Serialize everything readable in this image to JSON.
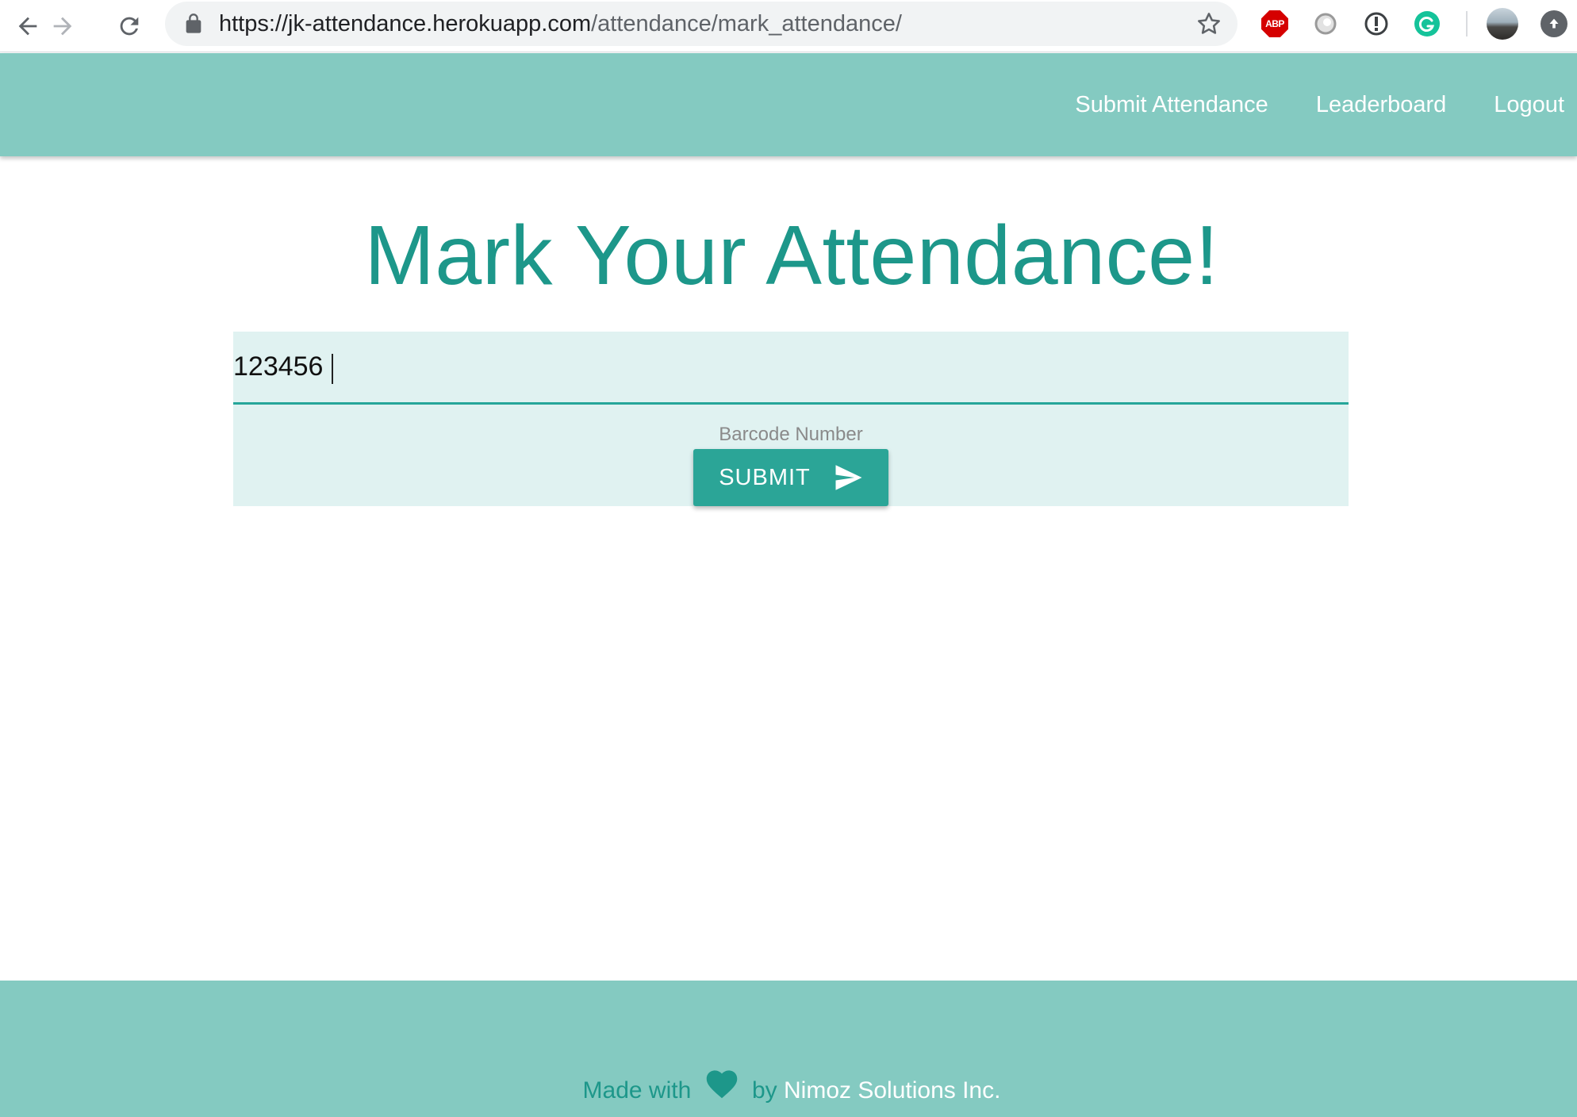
{
  "browser": {
    "url_host": "https://jk-attendance.herokuapp.com",
    "url_path": "/attendance/mark_attendance/",
    "extensions": {
      "abp_label": "ABP"
    }
  },
  "header": {
    "nav": [
      {
        "label": "Submit Attendance"
      },
      {
        "label": "Leaderboard"
      },
      {
        "label": "Logout"
      }
    ]
  },
  "main": {
    "title": "Mark Your Attendance!",
    "barcode_input": {
      "value": "123456",
      "label": "Barcode Number"
    },
    "submit_label": "SUBMIT"
  },
  "footer": {
    "made_with": "Made with",
    "by": "by",
    "company": "Nimoz Solutions Inc."
  },
  "colors": {
    "primary": "#26a69a",
    "header_bg": "#84cac1",
    "title": "#1d978a",
    "form_bg": "#e0f2f1"
  },
  "icons": {
    "back": "arrow-left",
    "forward": "arrow-right",
    "reload": "reload",
    "lock": "lock",
    "star": "star",
    "submit": "send",
    "footer": "heart"
  }
}
